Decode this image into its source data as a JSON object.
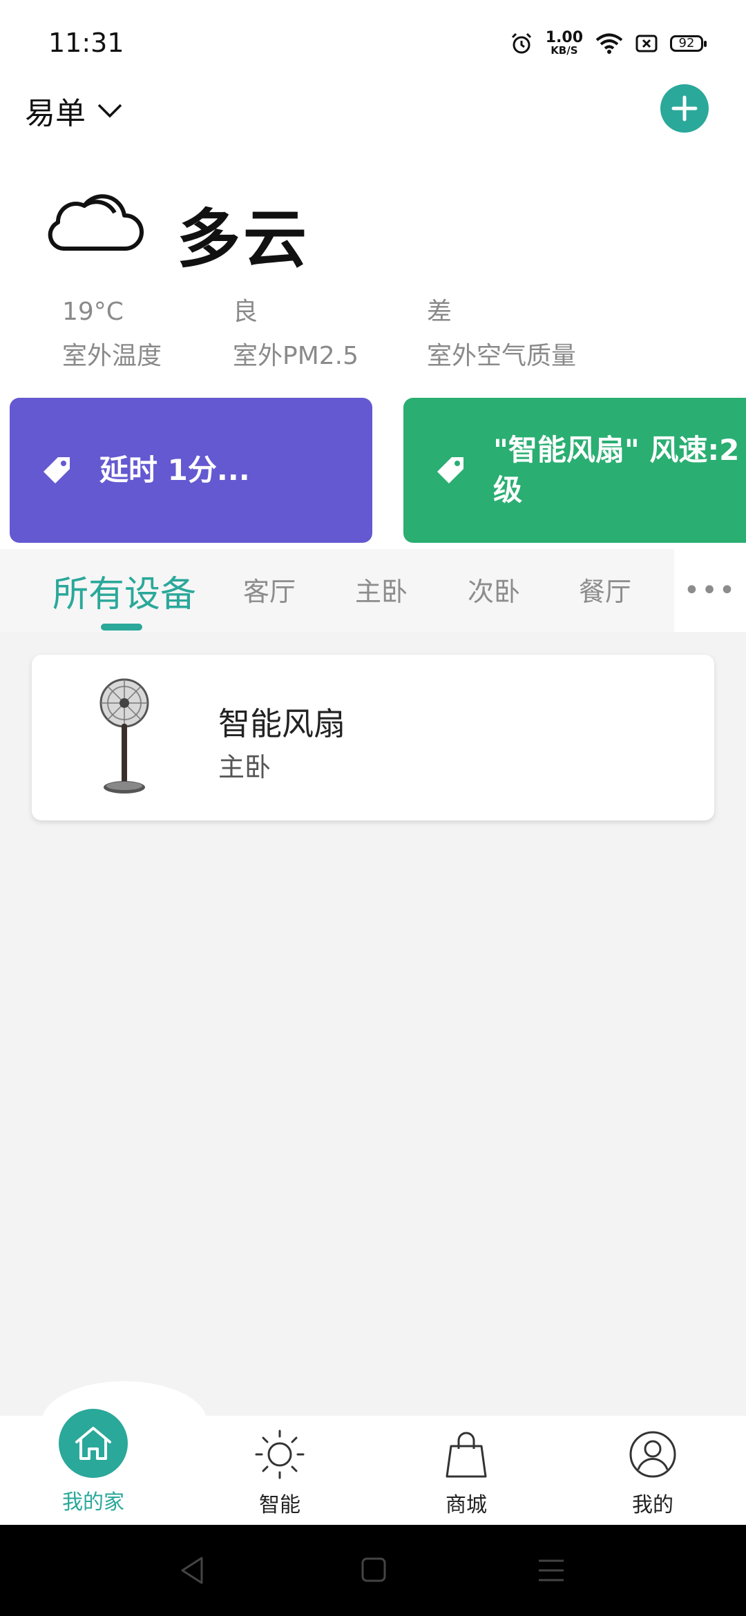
{
  "status_bar": {
    "time": "11:31",
    "net_speed_value": "1.00",
    "net_speed_unit": "KB/S",
    "battery": "92"
  },
  "header": {
    "home_name": "易单",
    "icons": [
      "chevron-down-icon",
      "plus-icon"
    ]
  },
  "weather": {
    "condition": "多云",
    "icon": "cloud-icon",
    "stats": [
      {
        "value": "19°C",
        "label": "室外温度"
      },
      {
        "value": "良",
        "label": "室外PM2.5"
      },
      {
        "value": "差",
        "label": "室外空气质量"
      }
    ]
  },
  "scenes": [
    {
      "label": "延时 1分...",
      "color": "#6459d1",
      "icon": "tag-icon"
    },
    {
      "label": "\"智能风扇\" 风速:2级",
      "color": "#2aae72",
      "icon": "tag-icon"
    }
  ],
  "tabs": [
    "所有设备",
    "客厅",
    "主卧",
    "次卧",
    "餐厅"
  ],
  "tabs_more": "•••",
  "devices": [
    {
      "name": "智能风扇",
      "room": "主卧",
      "icon": "standing-fan-icon"
    }
  ],
  "bottom_nav": [
    {
      "label": "我的家",
      "icon": "home-icon",
      "active": true
    },
    {
      "label": "智能",
      "icon": "sun-icon",
      "active": false
    },
    {
      "label": "商城",
      "icon": "shopping-bag-icon",
      "active": false
    },
    {
      "label": "我的",
      "icon": "user-icon",
      "active": false
    }
  ],
  "colors": {
    "accent": "#2aa89a",
    "scene_purple": "#6459d1",
    "scene_green": "#2aae72"
  }
}
